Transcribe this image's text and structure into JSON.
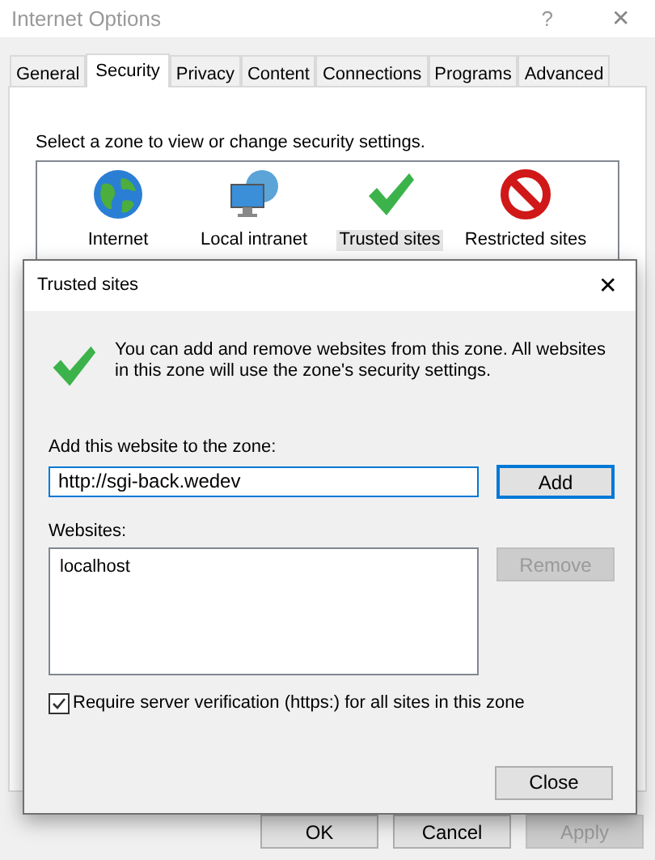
{
  "window": {
    "title": "Internet Options",
    "help": "?",
    "close": "✕"
  },
  "tabs": [
    {
      "label": "General",
      "selected": false
    },
    {
      "label": "Security",
      "selected": true
    },
    {
      "label": "Privacy",
      "selected": false
    },
    {
      "label": "Content",
      "selected": false
    },
    {
      "label": "Connections",
      "selected": false
    },
    {
      "label": "Programs",
      "selected": false
    },
    {
      "label": "Advanced",
      "selected": false
    }
  ],
  "zone_prompt": "Select a zone to view or change security settings.",
  "zones": [
    {
      "kind": "globe",
      "label": "Internet",
      "selected": false
    },
    {
      "kind": "intranet",
      "label": "Local intranet",
      "selected": false
    },
    {
      "kind": "check",
      "label": "Trusted sites",
      "selected": true
    },
    {
      "kind": "blocked",
      "label": "Restricted sites",
      "selected": false
    }
  ],
  "buttons": [
    {
      "label": "OK",
      "disabled": false
    },
    {
      "label": "Cancel",
      "disabled": false
    },
    {
      "label": "Apply",
      "disabled": true
    }
  ],
  "dialog": {
    "title": "Trusted sites",
    "close": "✕",
    "description": "You can add and remove websites from this zone. All websites in this zone will use the zone's security settings.",
    "add_label": "Add this website to the zone:",
    "add_value": "http://sgi-back.wedev",
    "add_button": {
      "label": "Add",
      "disabled": false
    },
    "websites_label": "Websites:",
    "websites": [
      {
        "label": "localhost",
        "selected": false
      }
    ],
    "remove_button": {
      "label": "Remove",
      "disabled": true
    },
    "require_https": {
      "label": "Require server verification (https:) for all sites in this zone",
      "checked": true
    },
    "close_button": {
      "label": "Close",
      "disabled": false
    }
  }
}
